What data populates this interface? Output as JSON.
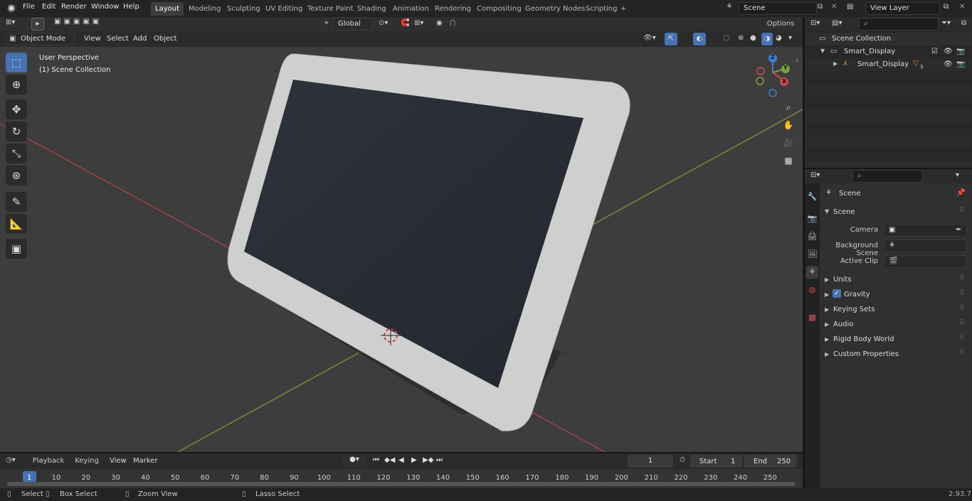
{
  "menus": [
    "File",
    "Edit",
    "Render",
    "Window",
    "Help"
  ],
  "workspaces": [
    "Layout",
    "Modeling",
    "Sculpting",
    "UV Editing",
    "Texture Paint",
    "Shading",
    "Animation",
    "Rendering",
    "Compositing",
    "Geometry Nodes",
    "Scripting"
  ],
  "scene_name": "Scene",
  "view_layer": "View Layer",
  "viewport": {
    "orientation": "Global",
    "options_label": "Options",
    "mode": "Object Mode",
    "header_menus": [
      "View",
      "Select",
      "Add",
      "Object"
    ],
    "overlay_title": "User Perspective",
    "overlay_subtitle": "(1) Scene Collection",
    "gizmo_axes": {
      "z": "Z",
      "y": "Y",
      "x": "X"
    }
  },
  "outliner": {
    "root": "Scene Collection",
    "items": [
      {
        "label": "Smart_Display"
      },
      {
        "label": "Smart_Display",
        "badge": "3"
      }
    ]
  },
  "properties": {
    "header": "Scene",
    "section": "Scene",
    "fields": [
      {
        "label": "Camera"
      },
      {
        "label": "Background Scene"
      },
      {
        "label": "Active Clip"
      }
    ],
    "panels": [
      "Units",
      "Gravity",
      "Keying Sets",
      "Audio",
      "Rigid Body World",
      "Custom Properties"
    ],
    "gravity_checked": true
  },
  "timeline": {
    "menus": [
      "Playback",
      "Keying",
      "View",
      "Marker"
    ],
    "current_frame": "1",
    "start_label": "Start",
    "start": "1",
    "end_label": "End",
    "end": "250",
    "ticks": [
      "1",
      "10",
      "20",
      "30",
      "40",
      "50",
      "60",
      "70",
      "80",
      "90",
      "100",
      "110",
      "120",
      "130",
      "140",
      "150",
      "160",
      "170",
      "180",
      "190",
      "200",
      "210",
      "220",
      "230",
      "240",
      "250"
    ]
  },
  "status": {
    "items": [
      "Select",
      "Box Select",
      "Zoom View",
      "Lasso Select"
    ],
    "version": "2.93.7"
  },
  "colors": {
    "accent": "#4772b3",
    "x_axis": "#c94a4a",
    "y_axis": "#7ca33a",
    "z_axis": "#3f7fd6",
    "grid": "#3a3a3a"
  }
}
